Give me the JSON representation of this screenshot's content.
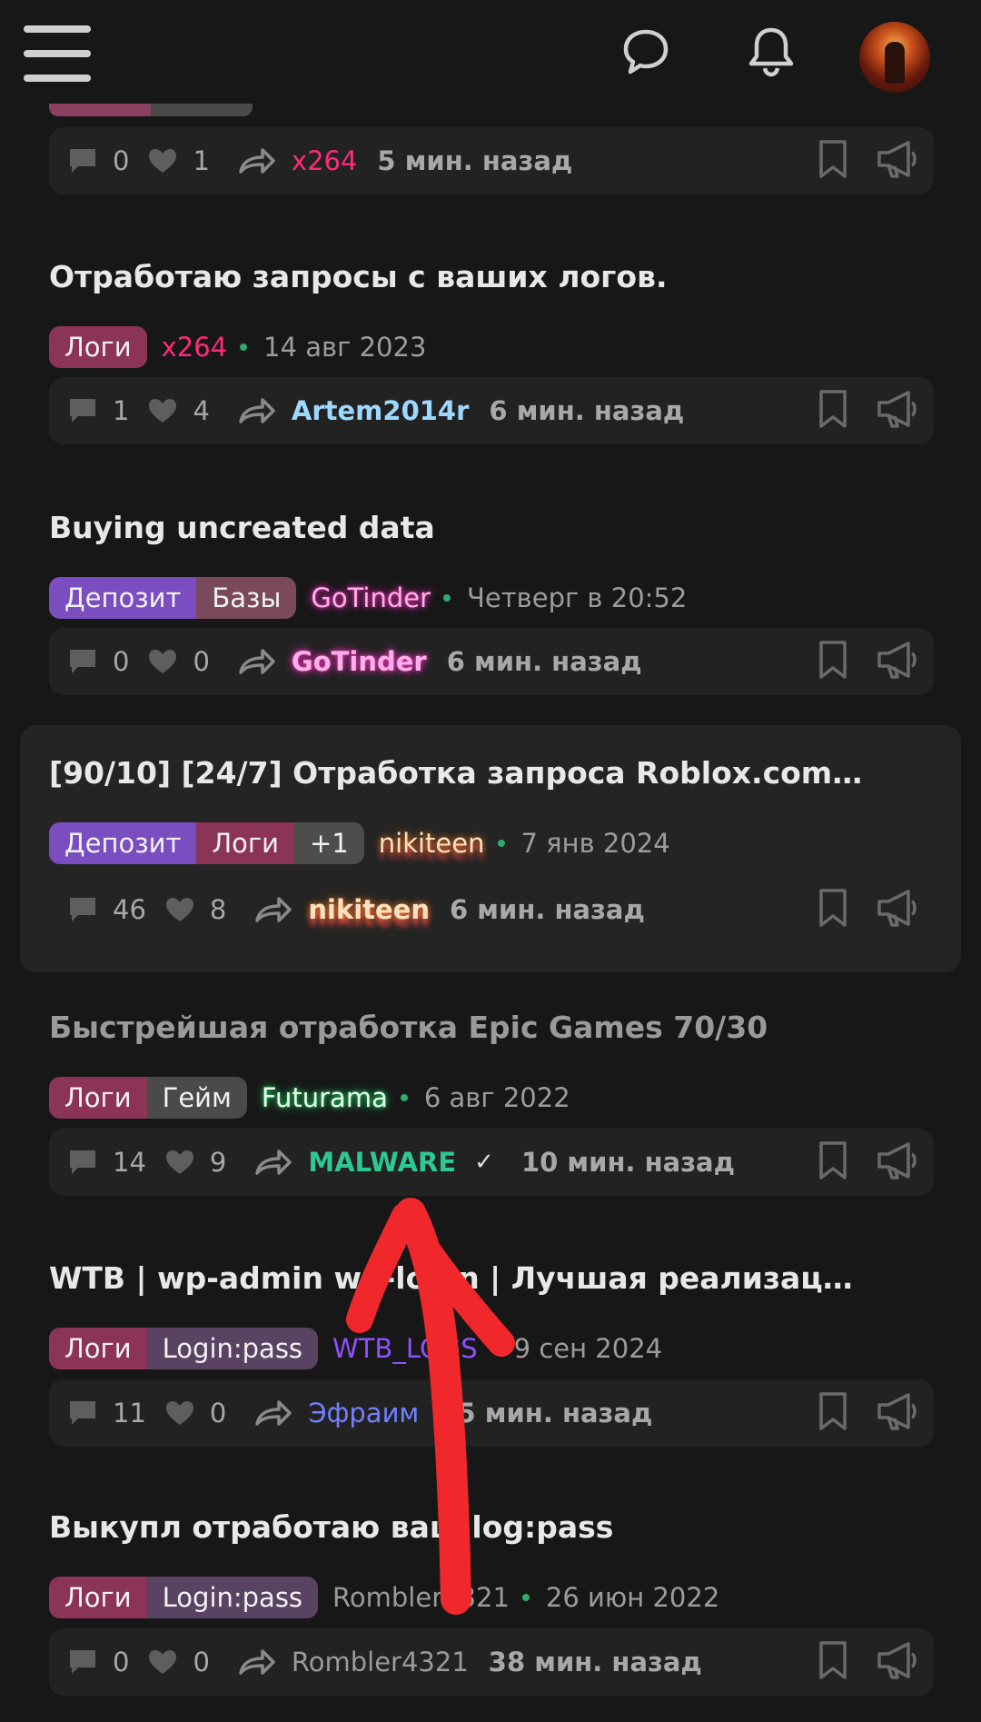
{
  "header": {
    "menu_icon": "hamburger-icon",
    "chat_icon": "speech-bubble-icon",
    "bell_icon": "bell-icon"
  },
  "threads": [
    {
      "title": "",
      "tags": [],
      "author": "",
      "date": "",
      "replies": "0",
      "likes": "1",
      "last_user": "x264",
      "last_time": "5 мин. назад"
    },
    {
      "title": "Отработаю запросы с ваших логов.",
      "tags": [
        "Логи"
      ],
      "author": "x264",
      "date": "14 авг 2023",
      "replies": "1",
      "likes": "4",
      "last_user": "Artem2014r",
      "last_time": "6 мин. назад"
    },
    {
      "title": "Buying uncreated data",
      "tags": [
        "Депозит",
        "Базы"
      ],
      "author": "GoTinder",
      "date": "Четверг в 20:52",
      "replies": "0",
      "likes": "0",
      "last_user": "GoTinder",
      "last_time": "6 мин. назад"
    },
    {
      "title": "[90/10] [24/7] Отработка запроса Roblox.com | ...",
      "tags": [
        "Депозит",
        "Логи",
        "+1"
      ],
      "author": "nikiteen",
      "date": "7 янв 2024",
      "replies": "46",
      "likes": "8",
      "last_user": "nikiteen",
      "last_time": "6 мин. назад"
    },
    {
      "title": "Быстрейшая отработка Epic Games 70/30",
      "tags": [
        "Логи",
        "Гейм"
      ],
      "author": "Futurama",
      "date": "6 авг 2022",
      "replies": "14",
      "likes": "9",
      "last_user": "MALWARE",
      "last_user_check": "✓",
      "last_time": "10 мин. назад"
    },
    {
      "title": "WTB | wp-admin wp-login | Лучшая реализаци...",
      "tags": [
        "Логи",
        "Login:pass"
      ],
      "author": "WTB_LOGS",
      "date": "9 сен 2024",
      "replies": "11",
      "likes": "0",
      "last_user": "Эфраим",
      "last_time": "15 мин. назад"
    },
    {
      "title": "Выкупл отработаю ваш log:pass",
      "tags": [
        "Логи",
        "Login:pass"
      ],
      "author": "Rombler4321",
      "date": "26 июн 2022",
      "replies": "0",
      "likes": "0",
      "last_user": "Rombler4321",
      "last_time": "38 мин. назад"
    }
  ],
  "colors": {
    "background": "#171717",
    "accent_pink": "#ff2a7a",
    "tag_logi": "#8c3358",
    "tag_deposit": "#7a4ec0",
    "annotation_arrow": "#f0282c"
  }
}
